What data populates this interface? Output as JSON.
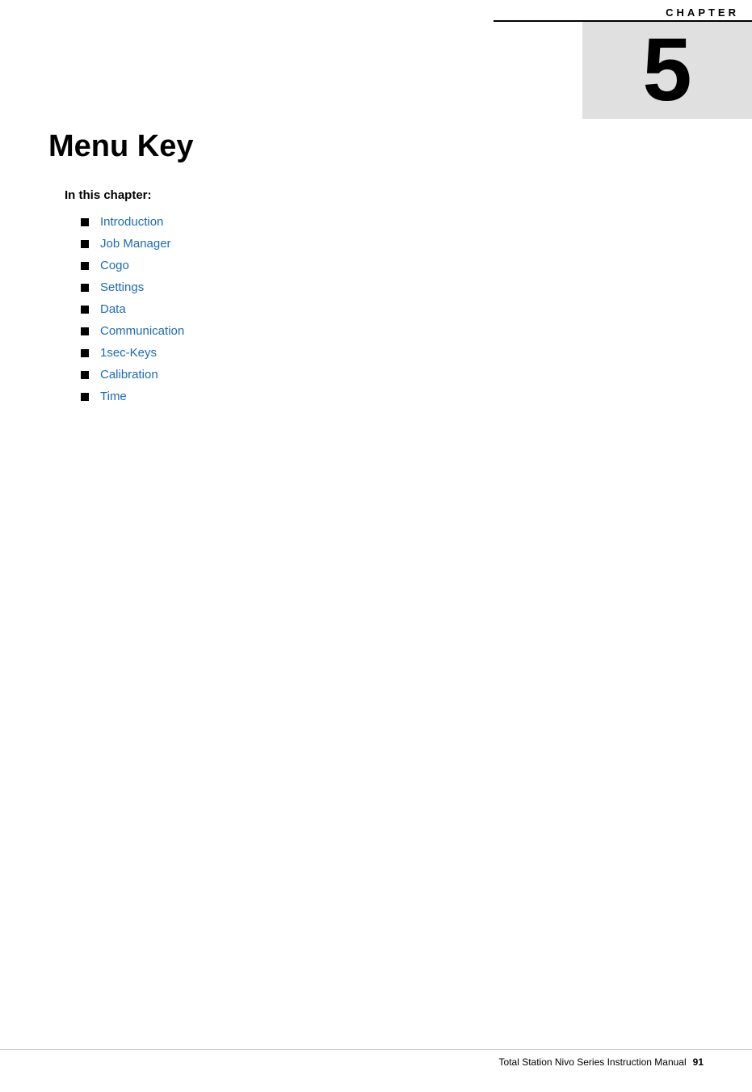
{
  "chapter": {
    "label": "CHAPTER",
    "number": "5"
  },
  "page": {
    "title": "Menu Key",
    "in_this_chapter_label": "In this chapter:"
  },
  "toc_items": [
    {
      "label": "Introduction"
    },
    {
      "label": "Job Manager"
    },
    {
      "label": "Cogo"
    },
    {
      "label": "Settings"
    },
    {
      "label": "Data"
    },
    {
      "label": "Communication"
    },
    {
      "label": "1sec-Keys"
    },
    {
      "label": "Calibration"
    },
    {
      "label": "Time"
    }
  ],
  "footer": {
    "text": "Total Station Nivo Series Instruction Manual",
    "page_number": "91"
  }
}
